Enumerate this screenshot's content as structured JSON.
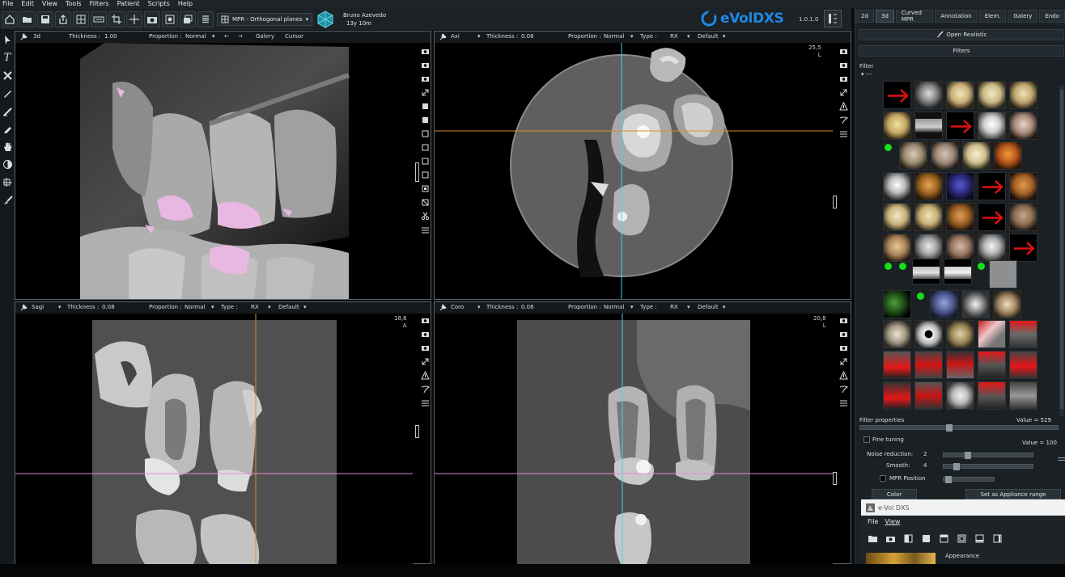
{
  "menu": [
    "File",
    "Edit",
    "View",
    "Tools",
    "Filters",
    "Patient",
    "Scripts",
    "Help"
  ],
  "toolbar": {
    "icons": [
      "home-icon",
      "folder-open-icon",
      "save-icon",
      "export-icon",
      "layout-icon",
      "panoramic-icon",
      "crop-icon",
      "crosshair-icon",
      "camera-icon",
      "filter-icon",
      "stack-icon",
      "list-icon"
    ],
    "mode_select": "MPR - Orthogonal planes",
    "patient_name": "Bruno Azevedo",
    "patient_age": "13y 10m",
    "logo_text": "eVolDXS",
    "version": "1.0.1.0"
  },
  "left_tools": [
    "pointer-icon",
    "text-icon",
    "cross-icon",
    "pen-icon",
    "pen-icon",
    "pencil-icon",
    "hand-icon",
    "contrast-icon",
    "mpr-icon",
    "brush-icon"
  ],
  "views": {
    "v3d": {
      "name": "3d",
      "thickness_label": "Thickness :",
      "thickness": "1.00",
      "proportion_label": "Proportion :",
      "proportion": "Normal",
      "galery": "Galery",
      "cursor": "Cursor",
      "arrow_left": "←",
      "arrow_right": "→"
    },
    "axi": {
      "name": "Axi",
      "thickness_label": "Thickness :",
      "thickness": "0.08",
      "proportion_label": "Proportion :",
      "proportion": "Normal",
      "type_label": "Type :",
      "type": "RX",
      "preset": "Default",
      "corner_val": "25,5",
      "corner_dir": "L"
    },
    "sagi": {
      "name": "Sagi",
      "thickness_label": "Thickness :",
      "thickness": "0.08",
      "proportion_label": "Proportion :",
      "proportion": "Normal",
      "type_label": "Type :",
      "type": "RX",
      "preset": "Default",
      "corner_val": "18,6",
      "corner_dir": "A"
    },
    "coro": {
      "name": "Coro",
      "thickness_label": "Thickness :",
      "thickness": "0.08",
      "proportion_label": "Proportion :",
      "proportion": "Normal",
      "type_label": "Type :",
      "type": "RX",
      "preset": "Default",
      "corner_val": "20,8",
      "corner_dir": "L"
    }
  },
  "right_panel": {
    "tabs": [
      "2d",
      "3d",
      "Curved MPR",
      "Annotation",
      "Elem.",
      "Galery",
      "Endo"
    ],
    "active_tab": "3d",
    "open_realistic": "Open Realistic",
    "filters_button": "Filters",
    "filter_label": "Filter",
    "filter_collapse": "---",
    "filter_properties": "Filter properties",
    "value_main": "Value = 529",
    "fine_tuning": "Fine tuning",
    "value_fine": "Value = 100",
    "noise_label": "Noise reduction:",
    "noise_value": "2",
    "smooth_label": "Smooth:",
    "smooth_value": "4",
    "mpr_position": "MPR Position",
    "color_button": "Color",
    "appliance_button": "Set as Appliance range"
  },
  "subwindow": {
    "title": "e-Vol DXS",
    "menu": [
      "File",
      "View"
    ],
    "appearance": "Appearance"
  },
  "colors": {
    "accent": "#1e88e5",
    "crosshair_cyan": "#45d3e0",
    "crosshair_orange": "#d8902a",
    "crosshair_pink": "#e68ad8",
    "marker_green": "#16e016",
    "arrow_red": "#e01010"
  }
}
